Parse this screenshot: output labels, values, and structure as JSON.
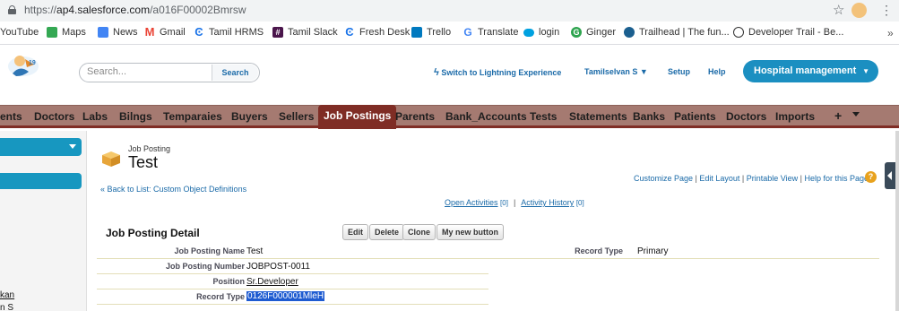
{
  "browser": {
    "url_scheme": "https://",
    "url_host": "ap4.salesforce.com",
    "url_path": "/a016F00002Bmrsw",
    "bookmarks": [
      {
        "label": "YouTube",
        "icon": "youtube-icon",
        "color": "#ff0000"
      },
      {
        "label": "Maps",
        "icon": "maps-icon",
        "color": "#34a853"
      },
      {
        "label": "News",
        "icon": "news-icon",
        "color": "#4285f4"
      },
      {
        "label": "Gmail",
        "icon": "gmail-icon",
        "color": "#ea4335"
      },
      {
        "label": "Tamil HRMS",
        "icon": "hrms-icon",
        "color": "#1a73e8"
      },
      {
        "label": "Tamil Slack",
        "icon": "slack-icon",
        "color": "#4a154b"
      },
      {
        "label": "Fresh Desk",
        "icon": "freshdesk-icon",
        "color": "#1a73e8"
      },
      {
        "label": "Trello",
        "icon": "trello-icon",
        "color": "#0079bf"
      },
      {
        "label": "Translate",
        "icon": "google-icon",
        "color": "#4285f4"
      },
      {
        "label": "login",
        "icon": "salesforce-cloud-icon",
        "color": "#00a1e0"
      },
      {
        "label": "Ginger",
        "icon": "ginger-icon",
        "color": "#2ea44f"
      },
      {
        "label": "Trailhead | The fun...",
        "icon": "trailhead-icon",
        "color": "#1b5f8f"
      },
      {
        "label": "Developer Trail - Be...",
        "icon": "developer-trail-icon",
        "color": "#333333"
      }
    ]
  },
  "header": {
    "search_placeholder": "Search...",
    "search_button": "Search",
    "lightning_link": "Switch to Lightning Experience",
    "user_menu": "Tamilselvan S ▼",
    "setup": "Setup",
    "help": "Help",
    "app_name": "Hospital management",
    "app_caret": "▼"
  },
  "tabs": [
    {
      "label": "ents",
      "active": false
    },
    {
      "label": "Doctors",
      "active": false
    },
    {
      "label": "Labs",
      "active": false
    },
    {
      "label": "Bilngs",
      "active": false
    },
    {
      "label": "Temparaies",
      "active": false
    },
    {
      "label": "Buyers",
      "active": false
    },
    {
      "label": "Sellers",
      "active": false
    },
    {
      "label": "Job Postings",
      "active": true
    },
    {
      "label": "Parents",
      "active": false
    },
    {
      "label": "Bank_Accounts",
      "active": false
    },
    {
      "label": "Tests",
      "active": false
    },
    {
      "label": "Statements",
      "active": false
    },
    {
      "label": "Banks",
      "active": false
    },
    {
      "label": "Patients",
      "active": false
    },
    {
      "label": "Doctors",
      "active": false
    },
    {
      "label": "Imports",
      "active": false
    }
  ],
  "tab_plus": "+",
  "sidebar": {
    "link1": "kan",
    "link2": "n S"
  },
  "record": {
    "object_type": "Job Posting",
    "name": "Test",
    "back_link": "« Back to List: Custom Object Definitions",
    "customize_page": "Customize Page",
    "edit_layout": "Edit Layout",
    "printable_view": "Printable View",
    "help_page": "Help for this Page",
    "help_icon": "?",
    "open_activities": "Open Activities",
    "open_activities_count": "[0]",
    "activity_history": "Activity History",
    "activity_history_count": "[0]"
  },
  "detail": {
    "title": "Job Posting Detail",
    "buttons": [
      "Edit",
      "Delete",
      "Clone",
      "My new button"
    ],
    "fields": [
      {
        "label": "Job Posting Name",
        "value": "Test"
      },
      {
        "label": "Job Posting Number",
        "value": "JOBPOST-0011"
      },
      {
        "label": "Position",
        "value": "Sr.Developer"
      },
      {
        "label": "Record Type",
        "value": "0126F000001MleH"
      }
    ],
    "right_field": {
      "label": "Record Type",
      "value": "Primary"
    }
  },
  "colors": {
    "tab_bar": "#a57a71",
    "tab_active": "#7f2d25",
    "app_button": "#1b8fc1",
    "link": "#1a6aa8"
  }
}
